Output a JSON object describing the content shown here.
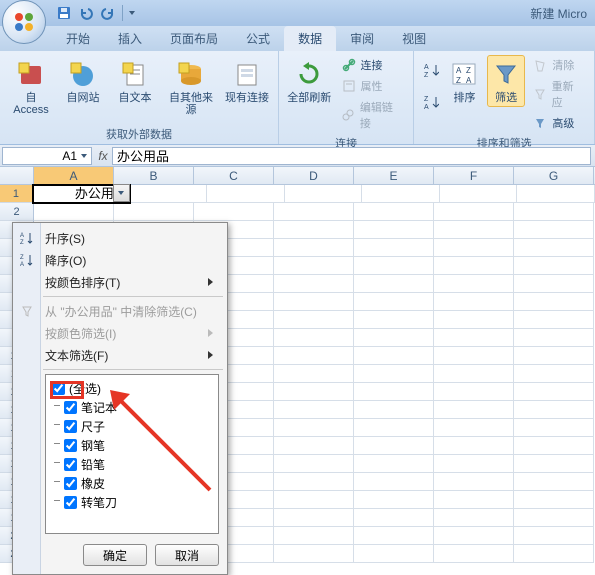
{
  "window": {
    "title_fragment": "新建 Micro"
  },
  "tabs": {
    "t0": "开始",
    "t1": "插入",
    "t2": "页面布局",
    "t3": "公式",
    "t4": "数据",
    "t5": "审阅",
    "t6": "视图"
  },
  "ribbon": {
    "group_external": {
      "access": "自 Access",
      "web": "自网站",
      "text": "自文本",
      "other": "自其他来源",
      "existing": "现有连接",
      "label": "获取外部数据"
    },
    "group_conn": {
      "refresh": "全部刷新",
      "connections": "连接",
      "properties": "属性",
      "editlinks": "编辑链接",
      "label": "连接"
    },
    "group_sort": {
      "sort": "排序",
      "filter": "筛选",
      "clear": "清除",
      "reapply": "重新应",
      "advanced": "高级",
      "label": "排序和筛选"
    }
  },
  "namebox": "A1",
  "formula": "办公用品",
  "columns": [
    "A",
    "B",
    "C",
    "D",
    "E",
    "F",
    "G"
  ],
  "cellA1": "办公用品",
  "filter_menu": {
    "asc": "升序(S)",
    "desc": "降序(O)",
    "sort_color": "按颜色排序(T)",
    "clear": "从 \"办公用品\" 中清除筛选(C)",
    "filter_color": "按颜色筛选(I)",
    "text_filter": "文本筛选(F)",
    "items": {
      "all": "(全选)",
      "i1": "笔记本",
      "i2": "尺子",
      "i3": "钢笔",
      "i4": "铅笔",
      "i5": "橡皮",
      "i6": "转笔刀"
    },
    "ok": "确定",
    "cancel": "取消"
  }
}
